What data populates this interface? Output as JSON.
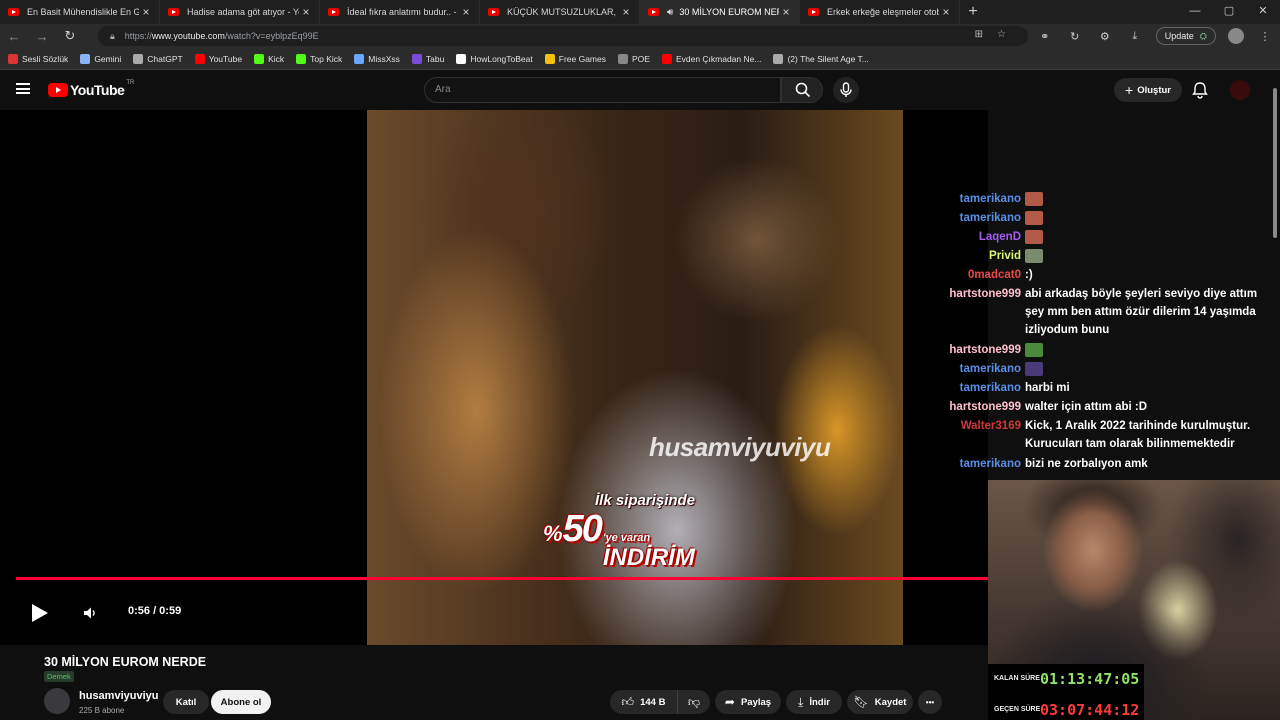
{
  "browser": {
    "tabs": [
      {
        "title": "En Basit Mühendislikle En Güvenli",
        "active": false,
        "audio": false
      },
      {
        "title": "Hadise adama göt atıyor - YouTube",
        "active": false,
        "audio": false
      },
      {
        "title": "İdeal fıkra anlatımı budur.. - YouTube",
        "active": false,
        "audio": false
      },
      {
        "title": "KÜÇÜK MUTSUZLUKLAR, ÇALMA",
        "active": false,
        "audio": false
      },
      {
        "title": "30 MİLYON EUROM NERDE",
        "active": true,
        "audio": true
      },
      {
        "title": "Erkek erkeğe eleşmeler otobüste",
        "active": false,
        "audio": false
      }
    ],
    "close_glyph": "×",
    "new_tab_glyph": "+",
    "window_controls": [
      "—",
      "▢",
      "✕"
    ],
    "address": {
      "prefix": "https://",
      "host": "www.youtube.com",
      "path": "/watch?v=eyblpzEq99E"
    },
    "update_label": "Update",
    "bookmarks": [
      {
        "label": "Sesli Sözlük",
        "icon_color": "#d33"
      },
      {
        "label": "Gemini",
        "icon_color": "#8ab4f8"
      },
      {
        "label": "ChatGPT",
        "icon_color": "#aaa"
      },
      {
        "label": "YouTube",
        "icon_color": "#f00"
      },
      {
        "label": "Kick",
        "icon_color": "#53fc18"
      },
      {
        "label": "Top Kick",
        "icon_color": "#53fc18"
      },
      {
        "label": "MissXss",
        "icon_color": "#6aa8ff"
      },
      {
        "label": "Tabu",
        "icon_color": "#7a4cd8"
      },
      {
        "label": "HowLongToBeat",
        "icon_color": "#fff"
      },
      {
        "label": "Free Games",
        "icon_color": "#f4c20d"
      },
      {
        "label": "POE",
        "icon_color": "#888"
      },
      {
        "label": "Evden Çıkmadan Ne...",
        "icon_color": "#f00"
      },
      {
        "label": "(2) The Silent Age T...",
        "icon_color": "#aaa"
      }
    ]
  },
  "youtube": {
    "logo_text": "YouTube",
    "logo_region": "TR",
    "search_placeholder": "Ara",
    "create_label": "Oluştur",
    "accent": "#ff0033"
  },
  "player": {
    "watermark": "husamviyuviyu",
    "promo_line1": "İlk siparişinde",
    "promo_pct": "%",
    "promo_num": "50",
    "promo_suffix": "'ye varan",
    "promo_word": "İNDİRİM",
    "time": "0:56 / 0:59",
    "progress_fraction": 0.95
  },
  "chat": [
    {
      "user": "tamerikano",
      "color": "#5a8fe8",
      "message": "",
      "emote": "#b25a48"
    },
    {
      "user": "tamerikano",
      "color": "#5a8fe8",
      "message": "",
      "emote": "#b25a48"
    },
    {
      "user": "LaqenD",
      "color": "#a25cf0",
      "message": "",
      "emote": "#b25a48"
    },
    {
      "user": "Privid",
      "color": "#d8f57a",
      "message": "",
      "emote": "#7a8a6a"
    },
    {
      "user": "0madcat0",
      "color": "#e84a4a",
      "message": ":)",
      "emote": ""
    },
    {
      "user": "hartstone999",
      "color": "#ffc0cb",
      "message": "abi arkadaş böyle şeyleri seviyo diye attım şey mm ben attım özür dilerim 14 yaşımda izliyodum bunu",
      "emote": ""
    },
    {
      "user": "hartstone999",
      "color": "#ffc0cb",
      "message": "",
      "emote": "#4a8a3a"
    },
    {
      "user": "tamerikano",
      "color": "#5a8fe8",
      "message": "",
      "emote": "#4a3a7a"
    },
    {
      "user": "tamerikano",
      "color": "#5a8fe8",
      "message": "harbi mi",
      "emote": ""
    },
    {
      "user": "hartstone999",
      "color": "#ffc0cb",
      "message": "walter için attım abi :D",
      "emote": ""
    },
    {
      "user": "Walter3169",
      "color": "#d03838",
      "message": "Kick, 1 Aralık 2022 tarihinde kurulmuştur. Kurucuları tam olarak bilinmemektedir",
      "emote": ""
    },
    {
      "user": "tamerikano",
      "color": "#5a8fe8",
      "message": "bizi ne zorbalıyon amk",
      "emote": ""
    }
  ],
  "overlay": {
    "remaining_label": "KALAN SÜRE",
    "remaining_value": "01:13:47:05",
    "remaining_color": "#8ee36a",
    "elapsed_label": "GEÇEN SÜRE",
    "elapsed_value": "03:07:44:12",
    "elapsed_color": "#ff3a3a"
  },
  "video_info": {
    "title": "30 MİLYON EUROM NERDE",
    "tag": "Demek",
    "channel": "husamviyuviyu",
    "subscribers": "225 B abone",
    "join_label": "Katıl",
    "subscribe_label": "Abone ol",
    "likes": "144 B",
    "share_label": "Paylaş",
    "download_label": "İndir",
    "save_label": "Kaydet",
    "more_label": "•••"
  }
}
